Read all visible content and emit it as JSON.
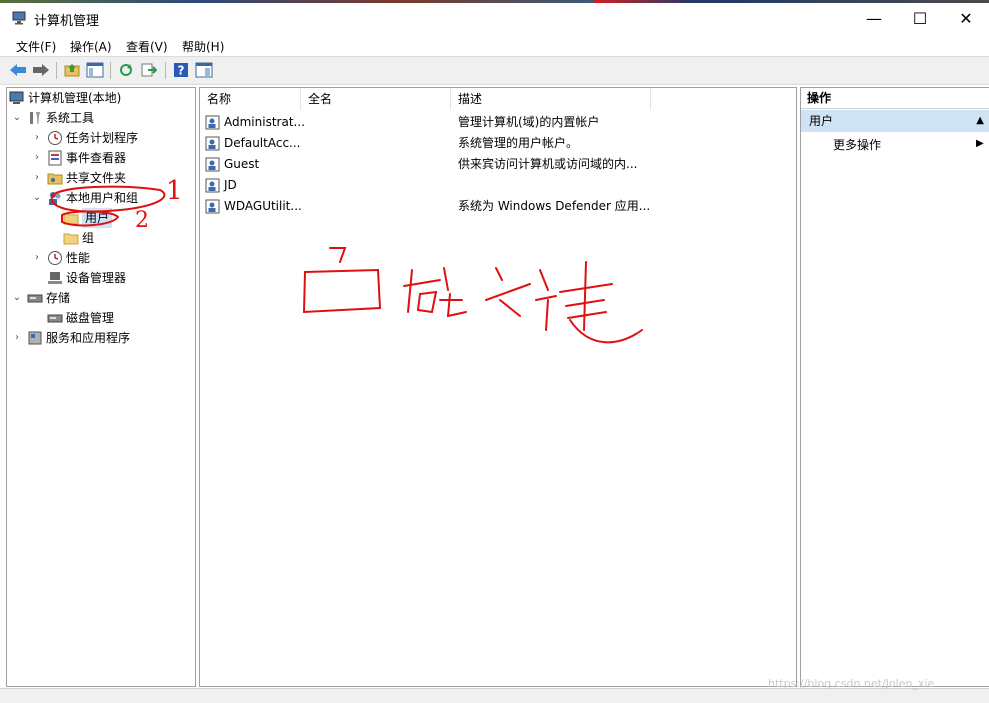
{
  "window": {
    "title": "计算机管理",
    "controls": {
      "minimize": "—",
      "maximize": "☐",
      "close": "✕"
    }
  },
  "menubar": [
    "文件(F)",
    "操作(A)",
    "查看(V)",
    "帮助(H)"
  ],
  "toolbar": {
    "icons": [
      "back-arrow-icon",
      "forward-arrow-icon",
      "up-folder-icon",
      "show-hide-tree-icon",
      "refresh-icon",
      "export-list-icon",
      "help-icon",
      "properties-pane-icon"
    ]
  },
  "tree": {
    "items": [
      {
        "label": "计算机管理(本地)",
        "level": 0,
        "arrow": "",
        "icon": "computer-icon"
      },
      {
        "label": "系统工具",
        "level": 1,
        "arrow": "⌄",
        "icon": "tools-icon"
      },
      {
        "label": "任务计划程序",
        "level": 2,
        "arrow": "›",
        "icon": "clock-icon"
      },
      {
        "label": "事件查看器",
        "level": 2,
        "arrow": "›",
        "icon": "event-viewer-icon"
      },
      {
        "label": "共享文件夹",
        "level": 2,
        "arrow": "›",
        "icon": "shared-folder-icon"
      },
      {
        "label": "本地用户和组",
        "level": 2,
        "arrow": "⌄",
        "icon": "users-group-icon"
      },
      {
        "label": "用户",
        "level": 3,
        "arrow": "",
        "icon": "folder-icon",
        "selected": true
      },
      {
        "label": "组",
        "level": 3,
        "arrow": "",
        "icon": "folder-icon"
      },
      {
        "label": "性能",
        "level": 2,
        "arrow": "›",
        "icon": "performance-icon"
      },
      {
        "label": "设备管理器",
        "level": 2,
        "arrow": "",
        "icon": "device-manager-icon"
      },
      {
        "label": "存储",
        "level": 1,
        "arrow": "⌄",
        "icon": "storage-icon"
      },
      {
        "label": "磁盘管理",
        "level": 2,
        "arrow": "",
        "icon": "disk-icon"
      },
      {
        "label": "服务和应用程序",
        "level": 1,
        "arrow": "›",
        "icon": "services-icon"
      }
    ]
  },
  "list": {
    "columns": [
      "名称",
      "全名",
      "描述"
    ],
    "rows": [
      {
        "name": "Administrat...",
        "fullname": "",
        "desc": "管理计算机(域)的内置帐户"
      },
      {
        "name": "DefaultAcc...",
        "fullname": "",
        "desc": "系统管理的用户帐户。"
      },
      {
        "name": "Guest",
        "fullname": "",
        "desc": "供来宾访问计算机或访问域的内..."
      },
      {
        "name": "JD",
        "fullname": "",
        "desc": ""
      },
      {
        "name": "WDAGUtilit...",
        "fullname": "",
        "desc": "系统为 Windows Defender 应用..."
      }
    ]
  },
  "actions": {
    "title": "操作",
    "section": "用户",
    "more": "更多操作"
  },
  "annotations": {
    "mark1": "1",
    "mark2": "2"
  },
  "watermark": "https://blog.csdn.net/Jolen_xie",
  "colors": {
    "selection": "#cfe3f5",
    "ink": "#e01010",
    "folder": "#f2d27a"
  }
}
